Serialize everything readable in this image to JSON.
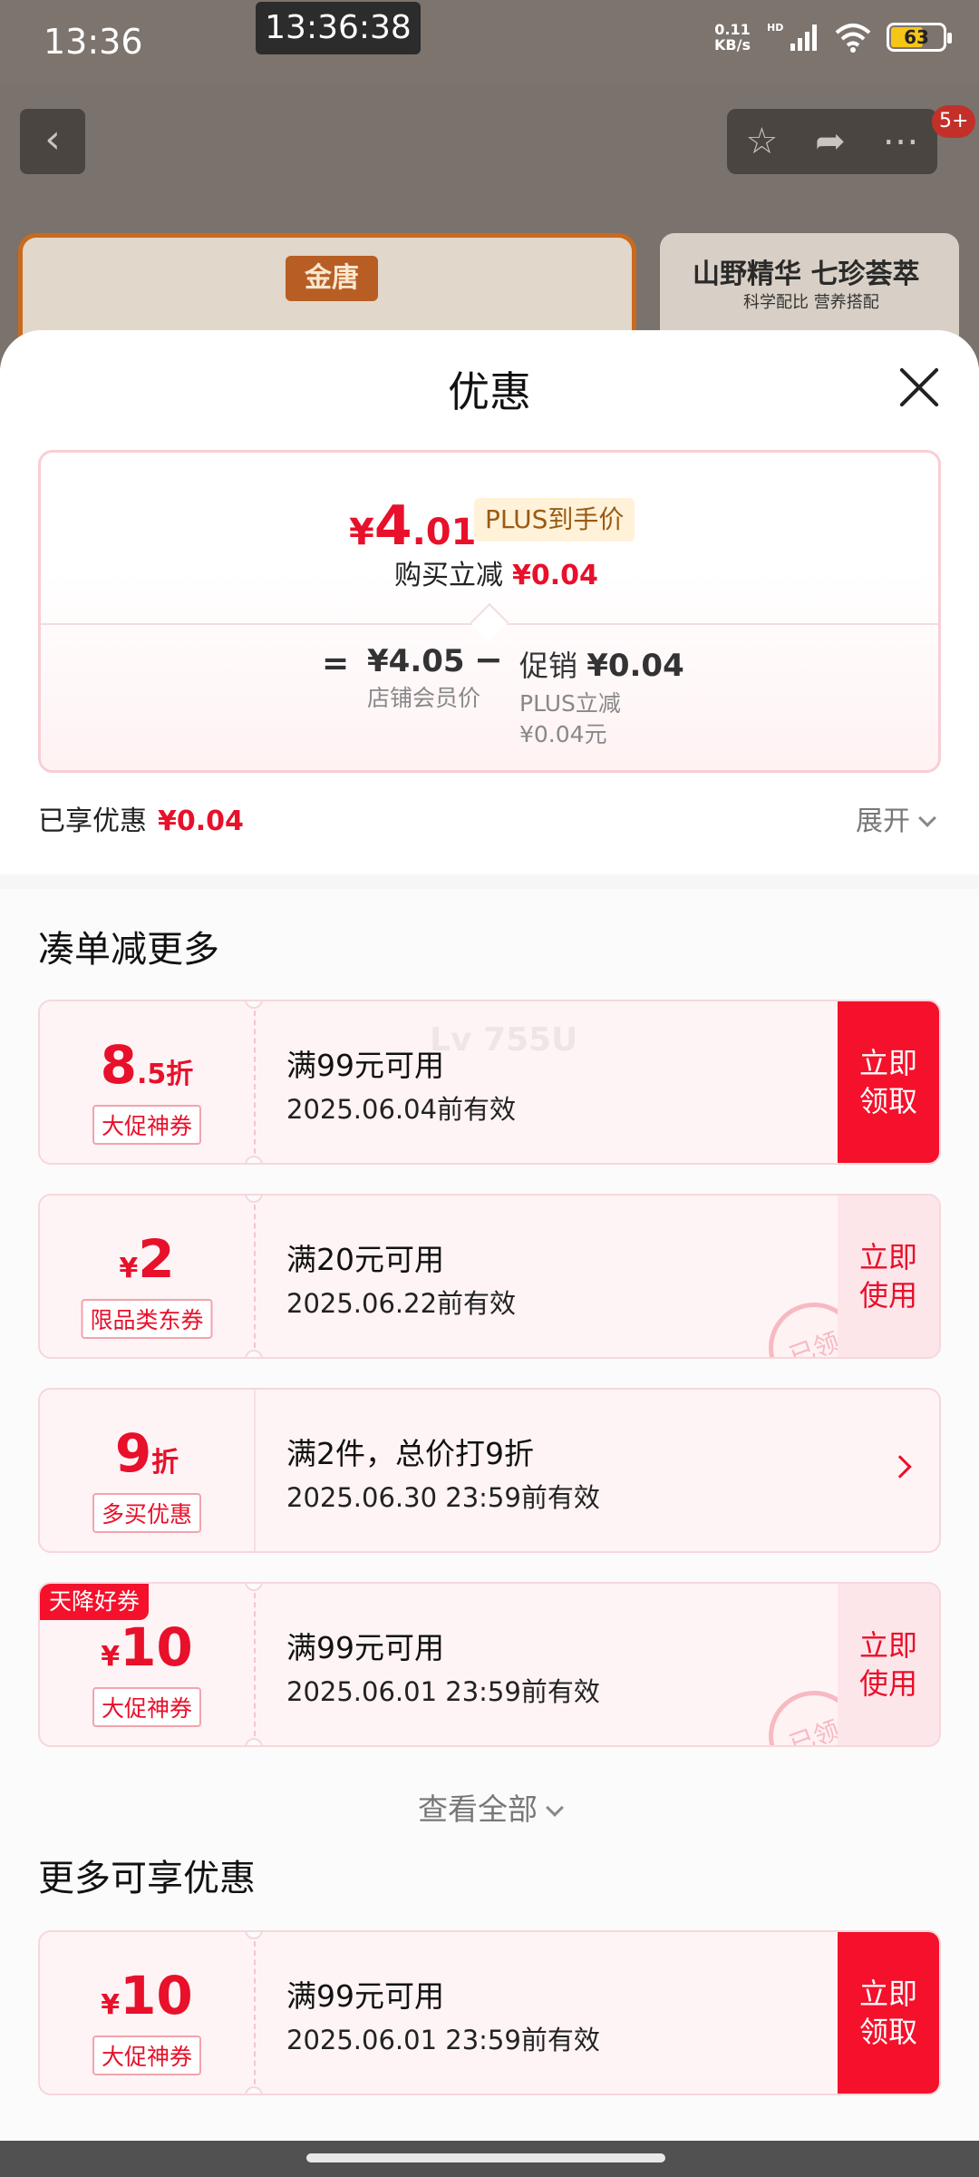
{
  "status_bar": {
    "time": "13:36",
    "clock_overlay": "13:36:38",
    "net_speed_value": "0.11",
    "net_speed_unit": "KB/s",
    "hd_label": "HD",
    "battery": "63"
  },
  "header": {
    "cart_badge": "5+"
  },
  "background_product": {
    "logo_text": "金唐",
    "promo_title": "山野精华 七珍荟萃",
    "promo_subtitle": "科学配比 营养搭配"
  },
  "sheet": {
    "title": "优惠",
    "price": {
      "currency": "¥",
      "integer": "4",
      "decimal": ".01",
      "tag": "PLUS到手价",
      "reduce_label": "购买立减",
      "reduce_amount": "¥0.04",
      "eq_sign": "=",
      "base_amount": "¥4.05",
      "base_label": "店铺会员价",
      "minus_sign": "−",
      "promo_label": "促销",
      "promo_amount": "¥0.04",
      "promo_detail": "PLUS立减¥0.04元"
    },
    "enjoyed_label": "已享优惠",
    "enjoyed_amount": "¥0.04",
    "expand_label": "展开"
  },
  "section_more_orders": {
    "title": "凑单减更多",
    "view_all": "查看全部"
  },
  "coupons": [
    {
      "amount_big": "8",
      "amount_small": ".5折",
      "type": "大促神券",
      "condition": "满99元可用",
      "validity": "2025.06.04前有效",
      "action": "立即领取",
      "action_style": "red"
    },
    {
      "amount_prefix": "¥",
      "amount_big": "2",
      "type": "限品类东券",
      "condition": "满20元可用",
      "validity": "2025.06.22前有效",
      "action": "立即使用",
      "action_style": "pink",
      "stamp": "已领"
    },
    {
      "amount_big": "9",
      "amount_small": "折",
      "type": "多买优惠",
      "condition": "满2件，总价打9折",
      "validity": "2025.06.30 23:59前有效",
      "action_style": "arrow"
    },
    {
      "corner_tag": "天降好券",
      "amount_prefix": "¥",
      "amount_big": "10",
      "type": "大促神券",
      "condition": "满99元可用",
      "validity": "2025.06.01 23:59前有效",
      "action": "立即使用",
      "action_style": "pink",
      "stamp": "已领"
    }
  ],
  "section_more_benefits": {
    "title": "更多可享优惠",
    "coupon": {
      "amount_prefix": "¥",
      "amount_big": "10",
      "type": "大促神券",
      "condition": "满99元可用",
      "validity": "2025.06.01 23:59前有效",
      "action": "立即领取"
    }
  },
  "watermark": "Lv 755U",
  "colors": {
    "accent_red": "#f5102b",
    "price_red": "#e8102a",
    "plus_tag_bg": "#fff2d9"
  }
}
